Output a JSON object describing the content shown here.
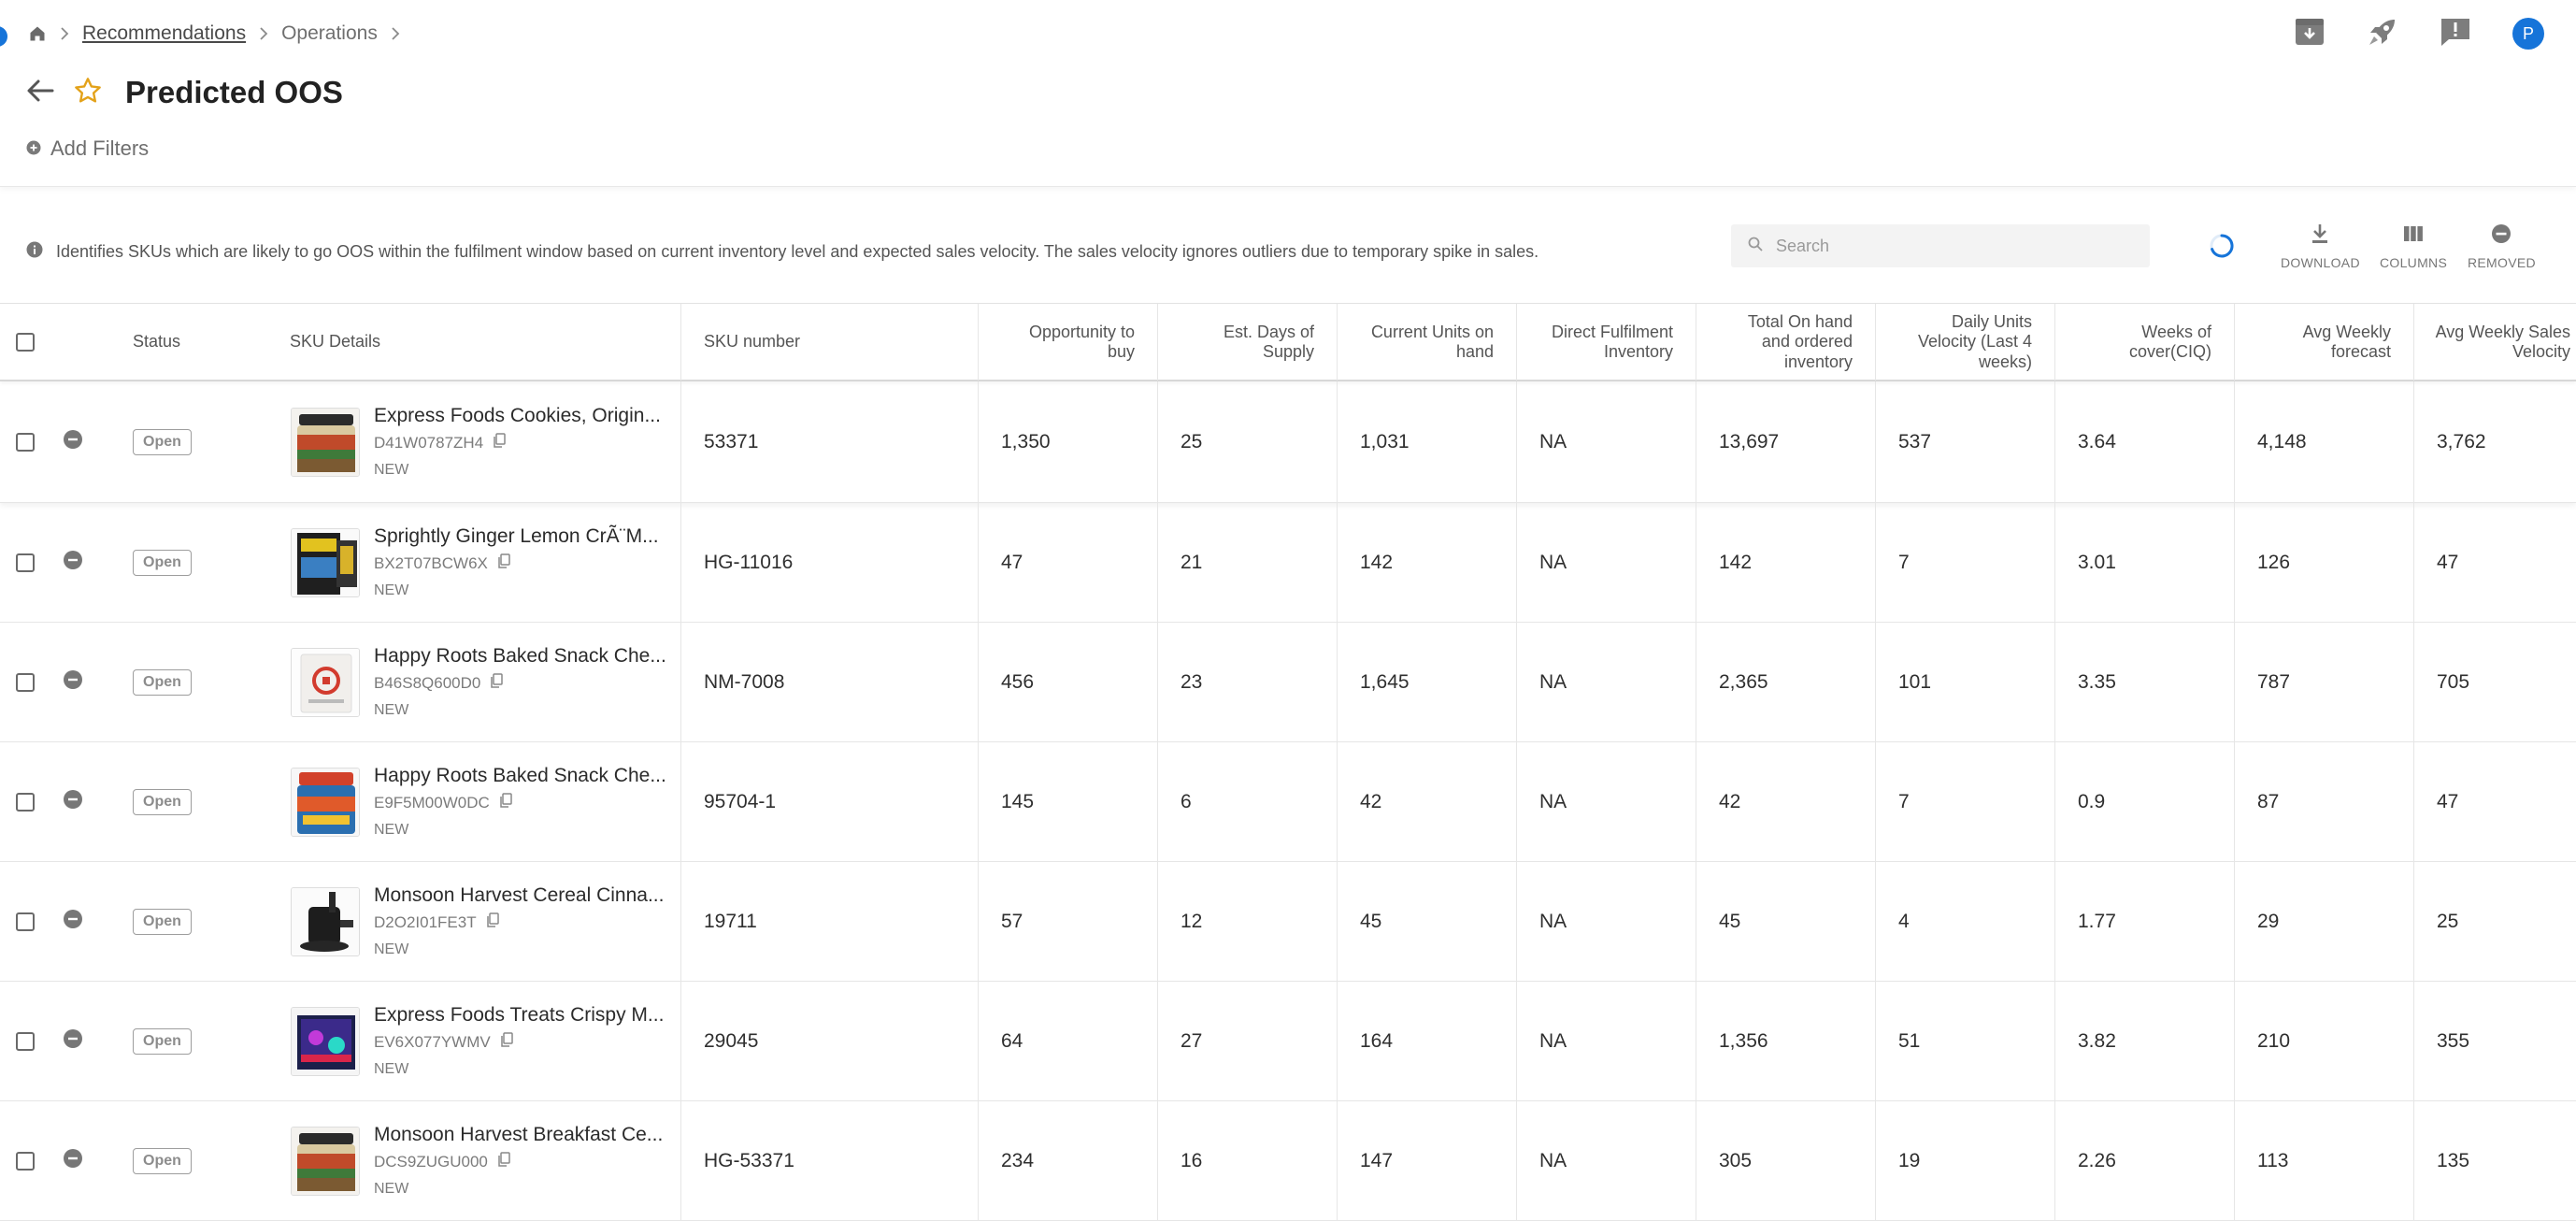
{
  "breadcrumb": {
    "items": [
      {
        "label": "Recommendations",
        "link": true
      },
      {
        "label": "Operations",
        "link": false
      }
    ]
  },
  "page": {
    "title": "Predicted OOS",
    "add_filters_label": "Add Filters"
  },
  "header_actions": {
    "avatar_initial": "P"
  },
  "toolbar": {
    "info_text": "Identifies SKUs which are likely to go OOS within the fulfilment window based on current inventory level and expected sales velocity. The sales velocity ignores outliers due to temporary spike in sales.",
    "search_placeholder": "Search",
    "download_label": "DOWNLOAD",
    "columns_label": "COLUMNS",
    "removed_label": "REMOVED"
  },
  "colors": {
    "accent_blue": "#1674d9",
    "star_gold": "#e3a21a"
  },
  "table": {
    "headers": {
      "status": "Status",
      "sku_details": "SKU Details",
      "sku_number": "SKU number",
      "opportunity": [
        "Opportunity to",
        "buy"
      ],
      "est_days": [
        "Est. Days of",
        "Supply"
      ],
      "current_units": [
        "Current Units on",
        "hand"
      ],
      "direct_fulfilment": [
        "Direct Fulfilment",
        "Inventory"
      ],
      "total_on_hand": [
        "Total On hand",
        "and ordered",
        "inventory"
      ],
      "daily_velocity": [
        "Daily Units",
        "Velocity (Last 4",
        "weeks)"
      ],
      "weeks_cover": [
        "Weeks of",
        "cover(CIQ)"
      ],
      "avg_forecast": [
        "Avg Weekly",
        "forecast"
      ],
      "avg_sales_velocity": [
        "Avg Weekly Sales",
        "Velocity"
      ]
    },
    "rows": [
      {
        "status": "Open",
        "name": "Express Foods Cookies, Origin...",
        "id": "D41W0787ZH4",
        "tag": "NEW",
        "sku_number": "53371",
        "opportunity": "1,350",
        "est_days": "25",
        "current_units": "1,031",
        "direct": "NA",
        "total": "13,697",
        "daily": "537",
        "weeks": "3.64",
        "forecast": "4,148",
        "velocity": "3,762",
        "thumb": "jar"
      },
      {
        "status": "Open",
        "name": "Sprightly Ginger Lemon CrÃ¨M...",
        "id": "BX2T07BCW6X",
        "tag": "NEW",
        "sku_number": "HG-11016",
        "opportunity": "47",
        "est_days": "21",
        "current_units": "142",
        "direct": "NA",
        "total": "142",
        "daily": "7",
        "weeks": "3.01",
        "forecast": "126",
        "velocity": "47",
        "thumb": "box-dark"
      },
      {
        "status": "Open",
        "name": "Happy Roots Baked Snack Che...",
        "id": "B46S8Q600D0",
        "tag": "NEW",
        "sku_number": "NM-7008",
        "opportunity": "456",
        "est_days": "23",
        "current_units": "1,645",
        "direct": "NA",
        "total": "2,365",
        "daily": "101",
        "weeks": "3.35",
        "forecast": "787",
        "velocity": "705",
        "thumb": "white-pack"
      },
      {
        "status": "Open",
        "name": "Happy Roots Baked Snack Che...",
        "id": "E9F5M00W0DC",
        "tag": "NEW",
        "sku_number": "95704-1",
        "opportunity": "145",
        "est_days": "6",
        "current_units": "42",
        "direct": "NA",
        "total": "42",
        "daily": "7",
        "weeks": "0.9",
        "forecast": "87",
        "velocity": "47",
        "thumb": "can"
      },
      {
        "status": "Open",
        "name": "Monsoon Harvest Cereal Cinna...",
        "id": "D2O2I01FE3T",
        "tag": "NEW",
        "sku_number": "19711",
        "opportunity": "57",
        "est_days": "12",
        "current_units": "45",
        "direct": "NA",
        "total": "45",
        "daily": "4",
        "weeks": "1.77",
        "forecast": "29",
        "velocity": "25",
        "thumb": "pump"
      },
      {
        "status": "Open",
        "name": "Express Foods Treats Crispy M...",
        "id": "EV6X077YWMV",
        "tag": "NEW",
        "sku_number": "29045",
        "opportunity": "64",
        "est_days": "27",
        "current_units": "164",
        "direct": "NA",
        "total": "1,356",
        "daily": "51",
        "weeks": "3.82",
        "forecast": "210",
        "velocity": "355",
        "thumb": "tank"
      },
      {
        "status": "Open",
        "name": "Monsoon Harvest Breakfast Ce...",
        "id": "DCS9ZUGU000",
        "tag": "NEW",
        "sku_number": "HG-53371",
        "opportunity": "234",
        "est_days": "16",
        "current_units": "147",
        "direct": "NA",
        "total": "305",
        "daily": "19",
        "weeks": "2.26",
        "forecast": "113",
        "velocity": "135",
        "thumb": "jar"
      }
    ]
  }
}
